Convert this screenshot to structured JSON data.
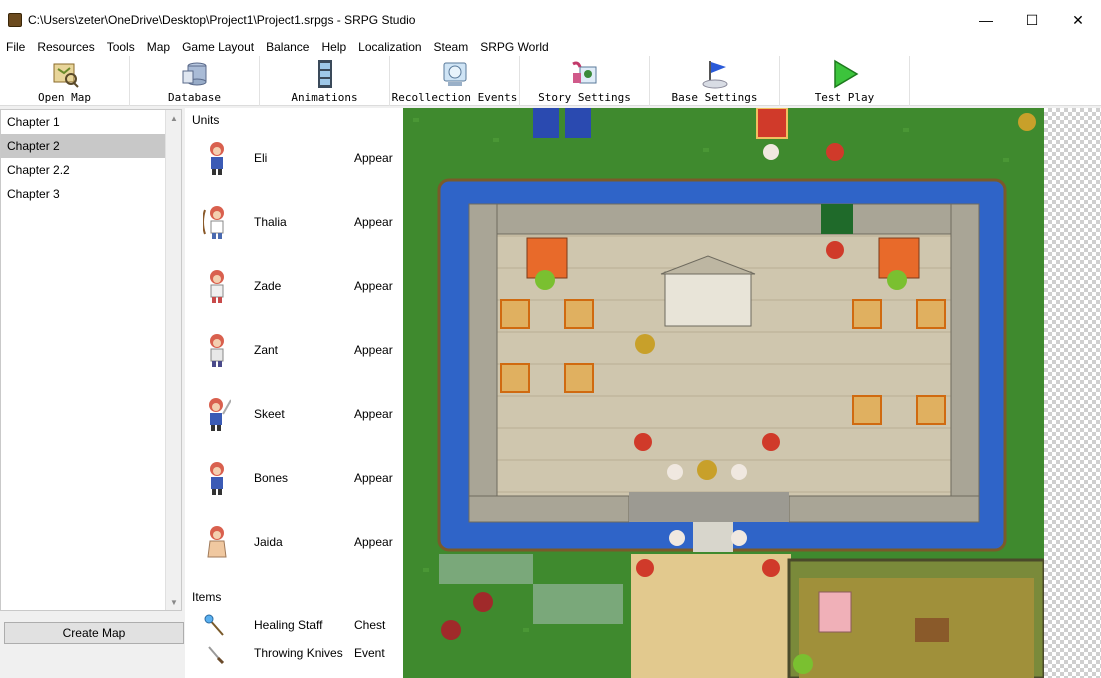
{
  "window": {
    "title": "C:\\Users\\zeter\\OneDrive\\Desktop\\Project1\\Project1.srpgs - SRPG Studio",
    "minimize": "—",
    "maximize": "☐",
    "close": "✕"
  },
  "menu": [
    "File",
    "Resources",
    "Tools",
    "Map",
    "Game Layout",
    "Balance",
    "Help",
    "Localization",
    "Steam",
    "SRPG World"
  ],
  "toolbar": [
    {
      "label": "Open Map",
      "icon": "open-map-icon"
    },
    {
      "label": "Database",
      "icon": "database-icon"
    },
    {
      "label": "Animations",
      "icon": "animations-icon"
    },
    {
      "label": "Recollection Events",
      "icon": "recollection-icon"
    },
    {
      "label": "Story Settings",
      "icon": "story-settings-icon"
    },
    {
      "label": "Base Settings",
      "icon": "base-settings-icon"
    },
    {
      "label": "Test Play",
      "icon": "test-play-icon"
    }
  ],
  "chapters": {
    "items": [
      "Chapter 1",
      "Chapter 2",
      "Chapter 2.2",
      "Chapter 3"
    ],
    "selected": "Chapter 2",
    "create_map_label": "Create Map"
  },
  "units_panel": {
    "units_title": "Units",
    "units": [
      {
        "name": "Eli",
        "status": "Appear",
        "hair": "#d9604e",
        "cloth": "#3b5bb5"
      },
      {
        "name": "Thalia",
        "status": "Appear",
        "hair": "#d9604e",
        "cloth": "#ffffff"
      },
      {
        "name": "Zade",
        "status": "Appear",
        "hair": "#d9604e",
        "cloth": "#f0f0f0"
      },
      {
        "name": "Zant",
        "status": "Appear",
        "hair": "#d9604e",
        "cloth": "#e8e8e8"
      },
      {
        "name": "Skeet",
        "status": "Appear",
        "hair": "#d9604e",
        "cloth": "#3b5bb5"
      },
      {
        "name": "Bones",
        "status": "Appear",
        "hair": "#d9604e",
        "cloth": "#3b5bb5"
      },
      {
        "name": "Jaida",
        "status": "Appear",
        "hair": "#d9604e",
        "cloth": "#f0c8a0"
      }
    ],
    "items_title": "Items",
    "items": [
      {
        "name": "Healing Staff",
        "type": "Chest",
        "icon": "staff-icon"
      },
      {
        "name": "Throwing Knives",
        "type": "Event",
        "icon": "knife-icon"
      }
    ]
  },
  "colors": {
    "grass": "#3f8a2e",
    "water": "#2f64c8",
    "stone_floor": "#cfc6ae",
    "wall": "#a9a596",
    "sand": "#e2c98e",
    "selected_chapter": "#c8c8c8"
  }
}
